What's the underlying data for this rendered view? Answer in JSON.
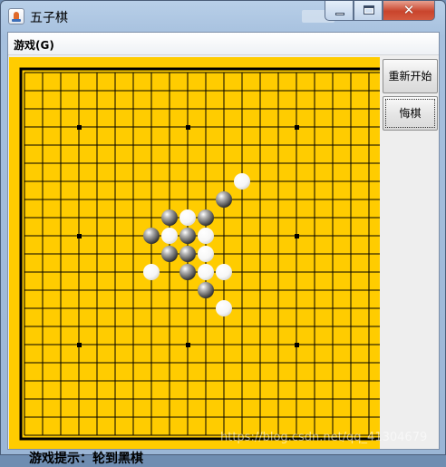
{
  "window": {
    "title": "五子棋",
    "controls": {
      "minimize": "minimize-icon",
      "maximize": "maximize-icon",
      "close": "close-icon"
    }
  },
  "menu": {
    "game": "游戏(G)"
  },
  "sidebar": {
    "restart_label": "重新开始",
    "undo_label": "悔棋"
  },
  "status": {
    "text": "游戏提示：轮到黑棋"
  },
  "watermark": "https://blog.csdn.net/qq_41304679",
  "colors": {
    "board": "#ffcc00",
    "grid": "#000000"
  },
  "board": {
    "size": 20,
    "star_points": [
      [
        3,
        3
      ],
      [
        9,
        3
      ],
      [
        15,
        3
      ],
      [
        3,
        9
      ],
      [
        15,
        9
      ],
      [
        3,
        15
      ],
      [
        9,
        15
      ],
      [
        15,
        15
      ]
    ],
    "stones": [
      {
        "col": 12,
        "row": 6,
        "color": "white"
      },
      {
        "col": 11,
        "row": 7,
        "color": "black"
      },
      {
        "col": 8,
        "row": 8,
        "color": "black"
      },
      {
        "col": 9,
        "row": 8,
        "color": "white"
      },
      {
        "col": 10,
        "row": 8,
        "color": "black"
      },
      {
        "col": 7,
        "row": 9,
        "color": "black"
      },
      {
        "col": 8,
        "row": 9,
        "color": "white"
      },
      {
        "col": 9,
        "row": 9,
        "color": "black"
      },
      {
        "col": 10,
        "row": 9,
        "color": "white"
      },
      {
        "col": 8,
        "row": 10,
        "color": "black"
      },
      {
        "col": 9,
        "row": 10,
        "color": "black"
      },
      {
        "col": 10,
        "row": 10,
        "color": "white"
      },
      {
        "col": 7,
        "row": 11,
        "color": "white"
      },
      {
        "col": 9,
        "row": 11,
        "color": "black"
      },
      {
        "col": 10,
        "row": 11,
        "color": "white"
      },
      {
        "col": 11,
        "row": 11,
        "color": "white"
      },
      {
        "col": 10,
        "row": 12,
        "color": "black"
      },
      {
        "col": 11,
        "row": 13,
        "color": "white"
      }
    ]
  }
}
